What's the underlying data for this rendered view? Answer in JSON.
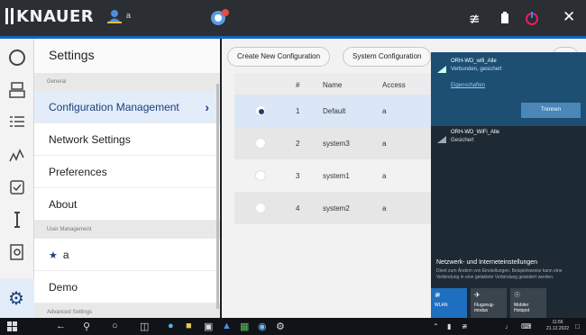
{
  "topbar": {
    "brand": "KNAUER",
    "user_label": "a"
  },
  "settings": {
    "title": "Settings",
    "sections": [
      {
        "label": "General",
        "items": [
          {
            "label": "Configuration Management",
            "active": true
          },
          {
            "label": "Network Settings"
          },
          {
            "label": "Preferences"
          },
          {
            "label": "About"
          }
        ]
      },
      {
        "label": "User Management",
        "items": [
          {
            "label": "a",
            "starred": true
          },
          {
            "label": "Demo"
          }
        ]
      },
      {
        "label": "Advanced Settings",
        "items": []
      }
    ]
  },
  "config": {
    "buttons": [
      "Create New Configuration",
      "System Configuration"
    ],
    "columns": [
      "#",
      "Name",
      "Access"
    ],
    "rows": [
      {
        "num": "1",
        "name": "Default",
        "access": "a",
        "selected": true
      },
      {
        "num": "2",
        "name": "system3",
        "access": "a"
      },
      {
        "num": "3",
        "name": "system1",
        "access": "a"
      },
      {
        "num": "4",
        "name": "system2",
        "access": "a"
      }
    ]
  },
  "network_flyout": {
    "net1_name": "ORH-WD_wifi_Alle",
    "net1_status": "Verbunden, gesichert",
    "net1_props": "Eigenschaften",
    "disconnect": "Trennen",
    "net2_name": "ORH-WD_WiFi_Alle",
    "net2_status": "Gesichert",
    "settings_title": "Netzwerk- und Interneteinstellungen",
    "settings_desc": "Dient zum Ändern von Einstellungen. Beispielsweise kann eine Verbindung in eine getaktete Verbindung geändert werden.",
    "tiles": [
      {
        "label": "WLAN",
        "on": true
      },
      {
        "label": "Flugzeug-modus"
      },
      {
        "label": "Mobiler Hotspot"
      }
    ]
  },
  "taskbar": {
    "time": "11:56",
    "date": "21.12.2022"
  },
  "colors": {
    "accent": "#1565c0",
    "selected_row": "#dbe7f7",
    "flyout_bg": "#1e2a33"
  }
}
